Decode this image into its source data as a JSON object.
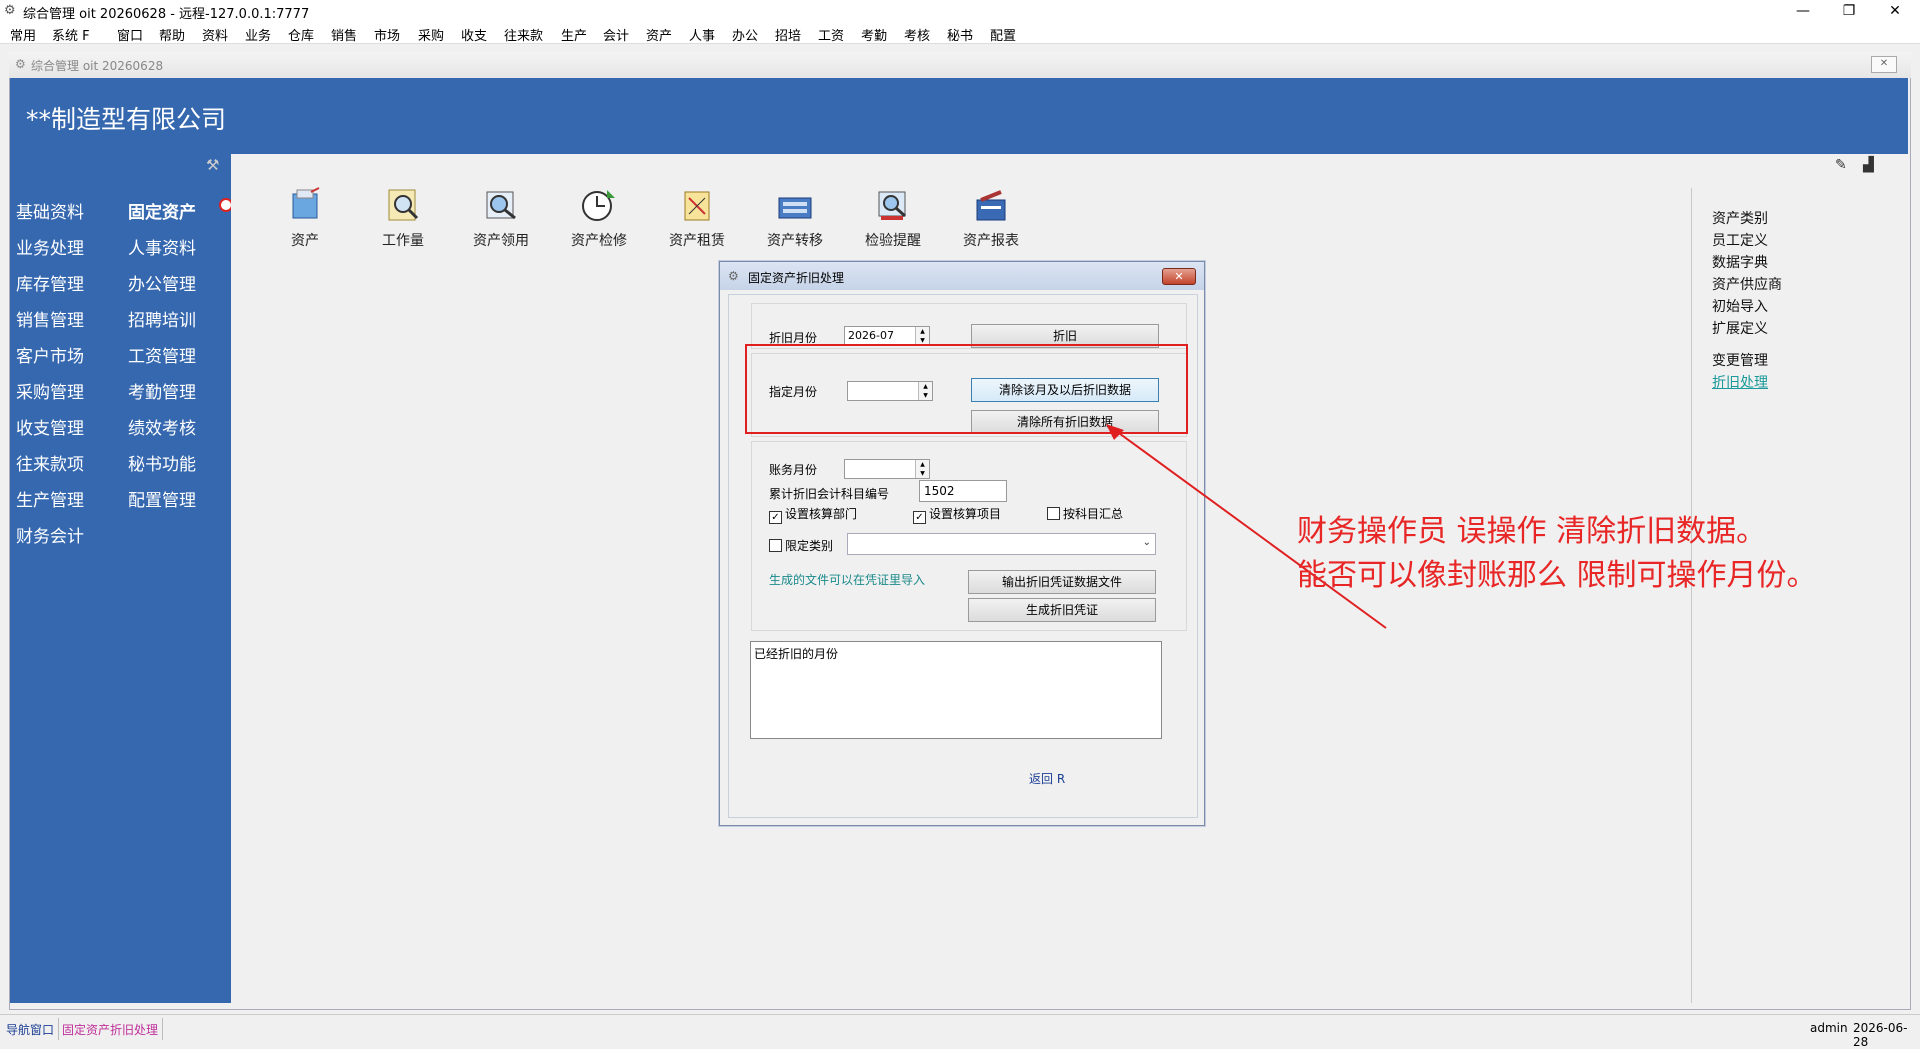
{
  "window": {
    "title": "综合管理 oit 20260628 - 远程-127.0.0.1:7777",
    "controls": [
      "—",
      "❐",
      "✕"
    ]
  },
  "menu": [
    "常用",
    "系统 F",
    "窗口",
    "帮助",
    "资料",
    "业务",
    "仓库",
    "销售",
    "市场",
    "采购",
    "收支",
    "往来款",
    "生产",
    "会计",
    "资产",
    "人事",
    "办公",
    "招培",
    "工资",
    "考勤",
    "考核",
    "秘书",
    "配置"
  ],
  "mdi": {
    "title": "综合管理 oit 20260628"
  },
  "company": "**制造型有限公司",
  "nav": {
    "col1": [
      "基础资料",
      "业务处理",
      "库存管理",
      "销售管理",
      "客户市场",
      "采购管理",
      "收支管理",
      "往来款项",
      "生产管理",
      "财务会计"
    ],
    "col2": [
      "固定资产",
      "人事资料",
      "办公管理",
      "招聘培训",
      "工资管理",
      "考勤管理",
      "绩效考核",
      "秘书功能",
      "配置管理"
    ]
  },
  "toolbar": [
    "资产",
    "工作量",
    "资产领用",
    "资产检修",
    "资产租赁",
    "资产转移",
    "检验提醒",
    "资产报表"
  ],
  "right_links": {
    "group1": [
      "资产类别",
      "员工定义",
      "数据字典",
      "资产供应商",
      "初始导入",
      "扩展定义"
    ],
    "group2": [
      "变更管理"
    ],
    "active": "折旧处理"
  },
  "dialog": {
    "title": "固定资产折旧处理",
    "depr_month_label": "折旧月份",
    "depr_month_value": "2026-07",
    "depr_button": "折旧",
    "spec_month_label": "指定月份",
    "spec_month_value": "",
    "clear_after_button": "清除该月及以后折旧数据",
    "clear_all_button": "清除所有折旧数据",
    "acct_month_label": "账务月份",
    "acct_month_value": "",
    "account_code_label": "累计折旧会计科目编号",
    "account_code_value": "1502",
    "chk_dept": "设置核算部门",
    "chk_project": "设置核算项目",
    "chk_summary": "按科目汇总",
    "chk_category": "限定类别",
    "hint": "生成的文件可以在凭证里导入",
    "export_button": "输出折旧凭证数据文件",
    "gen_button": "生成折旧凭证",
    "memo_text": "已经折旧的月份",
    "back": "返回 R"
  },
  "annotation": {
    "line1": "财务操作员 误操作 清除折旧数据。",
    "line2": "能否可以像封账那么 限制可操作月份。",
    "color": "#e82626"
  },
  "status": {
    "tabs": [
      "导航窗口",
      "固定资产折旧处理"
    ],
    "user": "admin",
    "date": "2026-06-28"
  }
}
